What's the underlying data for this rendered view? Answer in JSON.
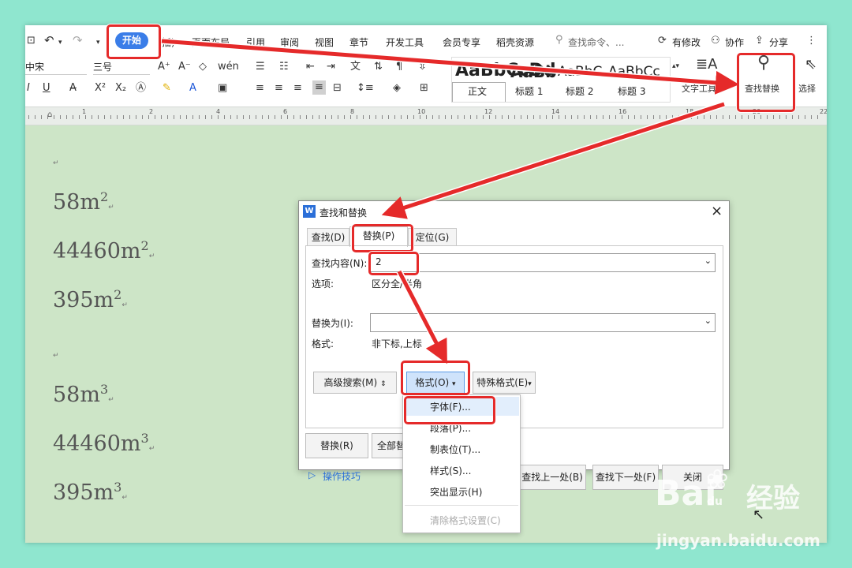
{
  "menu": {
    "start": "开始",
    "tabs": [
      "页面布局",
      "引用",
      "审阅",
      "视图",
      "章节",
      "开发工具",
      "会员专享",
      "稻壳资源"
    ],
    "search_placeholder": "查找命令、...",
    "right": {
      "modified": "有修改",
      "collab": "协作",
      "share": "分享"
    }
  },
  "font": {
    "name": "中宋",
    "size": "三号"
  },
  "styles": {
    "samples": [
      "AaBbCcDd",
      "AaBb",
      "AaBbC",
      "AaBbCc"
    ],
    "labels": [
      "正文",
      "标题 1",
      "标题 2",
      "标题 3"
    ]
  },
  "toolbar": {
    "text_tools": "文字工具",
    "find_replace": "查找替换",
    "select": "选择"
  },
  "ruler": {
    "numbers": [
      "1",
      "2",
      "4",
      "6",
      "8",
      "10",
      "12",
      "14",
      "16",
      "18",
      "20",
      "22"
    ]
  },
  "document": {
    "lines": [
      {
        "base": "58m",
        "sup": "2"
      },
      {
        "base": "44460m",
        "sup": "2"
      },
      {
        "base": "395m",
        "sup": "2"
      },
      {
        "base": "58m",
        "sup": "3"
      },
      {
        "base": "44460m",
        "sup": "3"
      },
      {
        "base": "395m",
        "sup": "3"
      }
    ],
    "para_mark": "↵"
  },
  "dialog": {
    "title": "查找和替换",
    "tabs": {
      "find": "查找(D)",
      "replace": "替换(P)",
      "goto": "定位(G)"
    },
    "find_label": "查找内容(N):",
    "find_value": "2",
    "options_label": "选项:",
    "options_value": "区分全/半角",
    "replace_label": "替换为(I):",
    "replace_value": "",
    "format_label": "格式:",
    "format_value": "非下标,上标",
    "btn_advanced": "高级搜索(M)",
    "btn_format": "格式(O)",
    "btn_special": "特殊格式(E)",
    "btn_replace": "替换(R)",
    "btn_replace_all": "全部替",
    "tips": "操作技巧",
    "btn_prev": "查找上一处(B)",
    "btn_next": "查找下一处(F)",
    "btn_close": "关闭"
  },
  "format_menu": {
    "items": [
      "字体(F)...",
      "段落(P)...",
      "制表位(T)...",
      "样式(S)...",
      "突出显示(H)"
    ],
    "disabled": "清除格式设置(C)"
  },
  "watermark": {
    "logo": "Bai",
    "logo2": "du",
    "jingyan": "经验",
    "url": "jingyan.baidu.com"
  },
  "colors": {
    "accent": "#3a7de8",
    "highlight": "#e52a2a",
    "doc_bg": "#cde5c7",
    "frame": "#8fe6cf"
  }
}
